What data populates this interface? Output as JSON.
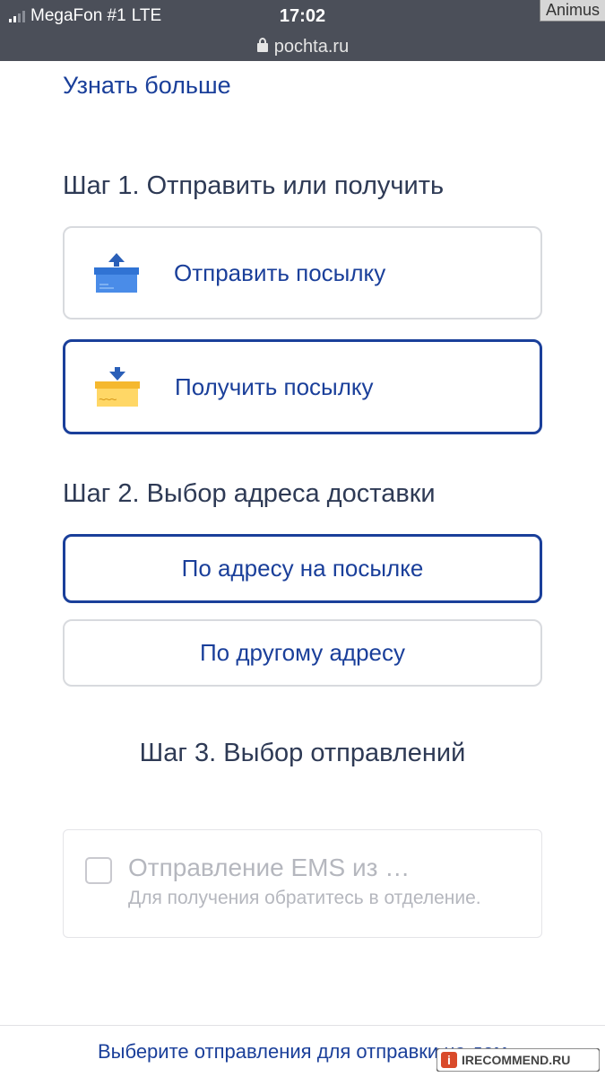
{
  "statusbar": {
    "carrier": "MegaFon #1",
    "network": "LTE",
    "time": "17:02"
  },
  "watermark_tag": "Animus",
  "url": "pochta.ru",
  "top_link": "Узнать больше",
  "step1": {
    "title": "Шаг 1. Отправить или получить",
    "option_send": "Отправить посылку",
    "option_receive": "Получить посылку"
  },
  "step2": {
    "title": "Шаг 2. Выбор адреса доставки",
    "option_on_parcel": "По адресу на посылке",
    "option_other": "По другому адресу"
  },
  "step3": {
    "title": "Шаг 3. Выбор отправлений",
    "shipment_title": "Отправление EMS из …",
    "shipment_sub": "Для получения обратитесь в отделение."
  },
  "bottom_message": "Выберите отправления для отправки на дом",
  "bottom_watermark": "IRECOMMEND.RU"
}
